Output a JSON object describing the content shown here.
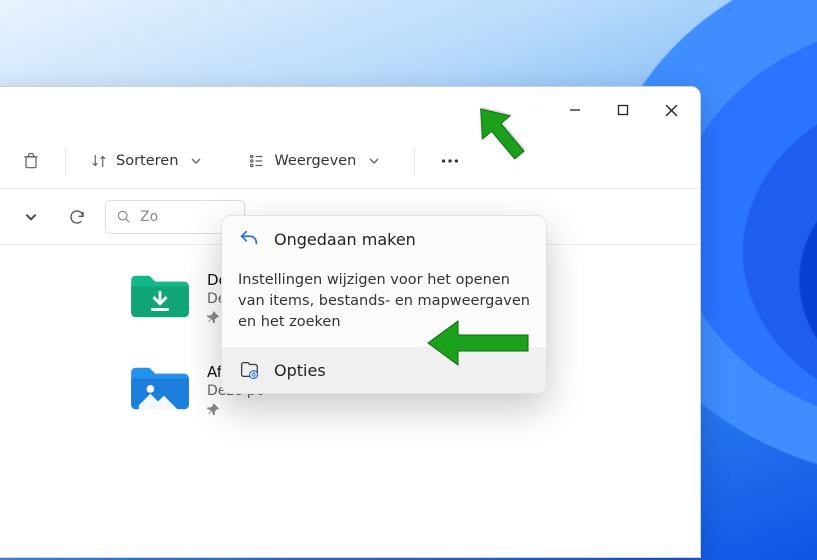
{
  "window": {
    "controls": {
      "minimize": "minimize",
      "maximize": "maximize",
      "close": "close"
    }
  },
  "toolbar": {
    "delete_tip": "Verwijderen",
    "sort_label": "Sorteren",
    "view_label": "Weergeven",
    "more_tip": "Meer"
  },
  "nav": {
    "search_placeholder": "Zo"
  },
  "dropdown": {
    "undo_label": "Ongedaan maken",
    "tooltip": "Instellingen wijzigen voor het openen van items, bestands- en mapweergaven en het zoeken",
    "options_label": "Opties"
  },
  "items": [
    {
      "name": "Downloads",
      "location": "Deze pc"
    },
    {
      "name": "Afbeeldingen",
      "location": "Deze pc"
    }
  ]
}
